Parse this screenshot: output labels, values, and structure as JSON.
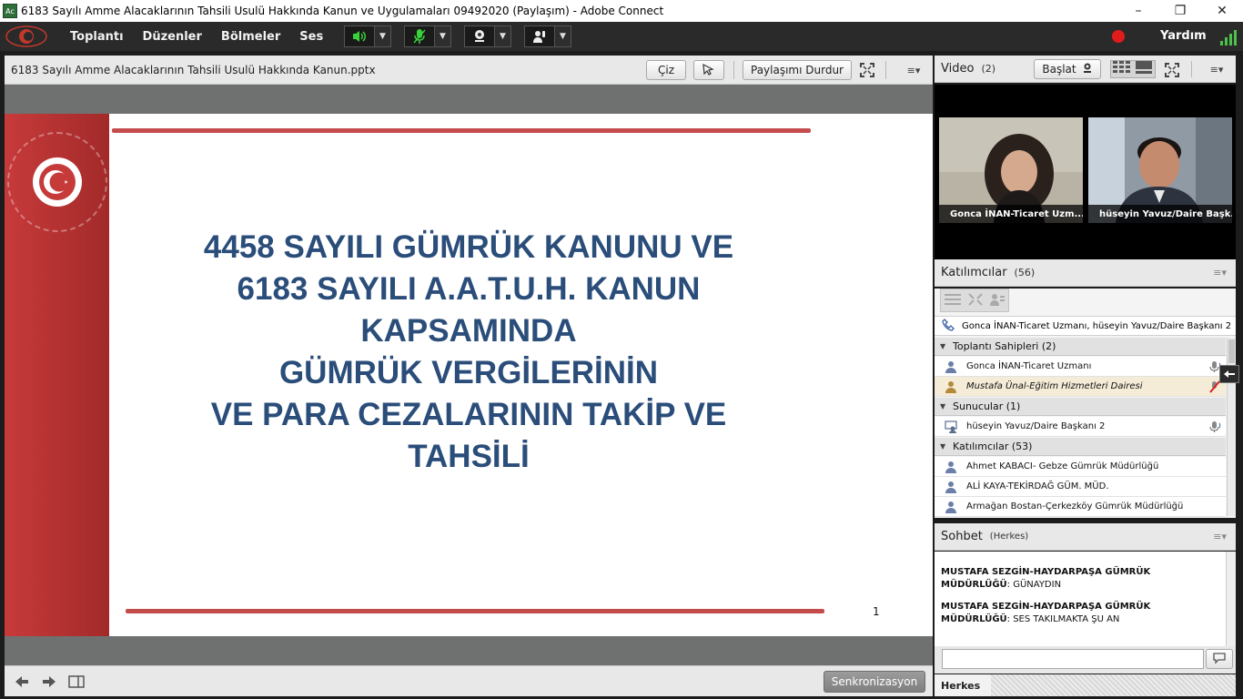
{
  "window": {
    "title": "6183 Sayılı Amme Alacaklarının Tahsili Usulü Hakkında Kanun ve Uygulamaları 09492020 (Paylaşım) - Adobe Connect",
    "app_icon": "Ac"
  },
  "menubar": {
    "items": [
      "Toplantı",
      "Düzenler",
      "Bölmeler",
      "Ses"
    ],
    "help": "Yardım",
    "colors": {
      "speaker_on": "#3ad13a",
      "mic_on": "#3ad13a",
      "record": "#e21c1c"
    }
  },
  "share_pod": {
    "title": "6183 Sayılı Amme Alacaklarının Tahsili Usulü Hakkında Kanun.pptx",
    "draw_button": "Çiz",
    "stop_sharing_button": "Paylaşımı Durdur",
    "sync_button": "Senkronizasyon",
    "slide": {
      "title_lines": [
        "4458 SAYILI GÜMRÜK KANUNU VE",
        "6183 SAYILI A.A.T.U.H. KANUN",
        "KAPSAMINDA",
        "GÜMRÜK VERGİLERİNİN",
        "VE PARA CEZALARININ TAKİP VE",
        "TAHSİLİ"
      ],
      "page_number": "1",
      "colors": {
        "title": "#2a4d7a",
        "band": "#c73a3a"
      }
    }
  },
  "video_pod": {
    "title": "Video",
    "count": "(2)",
    "start_button": "Başlat",
    "tiles": [
      {
        "caption": "Gonca İNAN-Ticaret Uzm..."
      },
      {
        "caption": "hüseyin Yavuz/Daire Başk..."
      }
    ]
  },
  "participants_pod": {
    "title": "Katılımcılar",
    "count": "(56)",
    "speaking_now": "Gonca İNAN-Ticaret Uzmanı, hüseyin Yavuz/Daire Başkanı 2",
    "groups": {
      "hosts": {
        "label": "Toplantı Sahipleri (2)",
        "people": [
          "Gonca İNAN-Ticaret Uzmanı",
          "Mustafa Ünal-Eğitim Hizmetleri Dairesi"
        ]
      },
      "presenters": {
        "label": "Sunucular (1)",
        "people": [
          "hüseyin Yavuz/Daire Başkanı 2"
        ]
      },
      "attendees": {
        "label": "Katılımcılar (53)",
        "people": [
          "Ahmet KABACI- Gebze Gümrük Müdürlüğü",
          "ALİ KAYA-TEKİRDAĞ GÜM. MÜD.",
          "Armağan Bostan-Çerkezköy Gümrük Müdürlüğü"
        ]
      }
    }
  },
  "chat_pod": {
    "title": "Sohbet",
    "scope": "(Herkes)",
    "messages": [
      {
        "sender": "MUSTAFA SEZGİN-HAYDARPAŞA GÜMRÜK MÜDÜRLÜĞÜ",
        "text": ": GÜNAYDIN"
      },
      {
        "sender": "MUSTAFA SEZGİN-HAYDARPAŞA GÜMRÜK MÜDÜRLÜĞÜ",
        "text": ": SES TAKILMAKTA ŞU AN"
      }
    ],
    "input_value": "",
    "recipient": "Herkes"
  }
}
